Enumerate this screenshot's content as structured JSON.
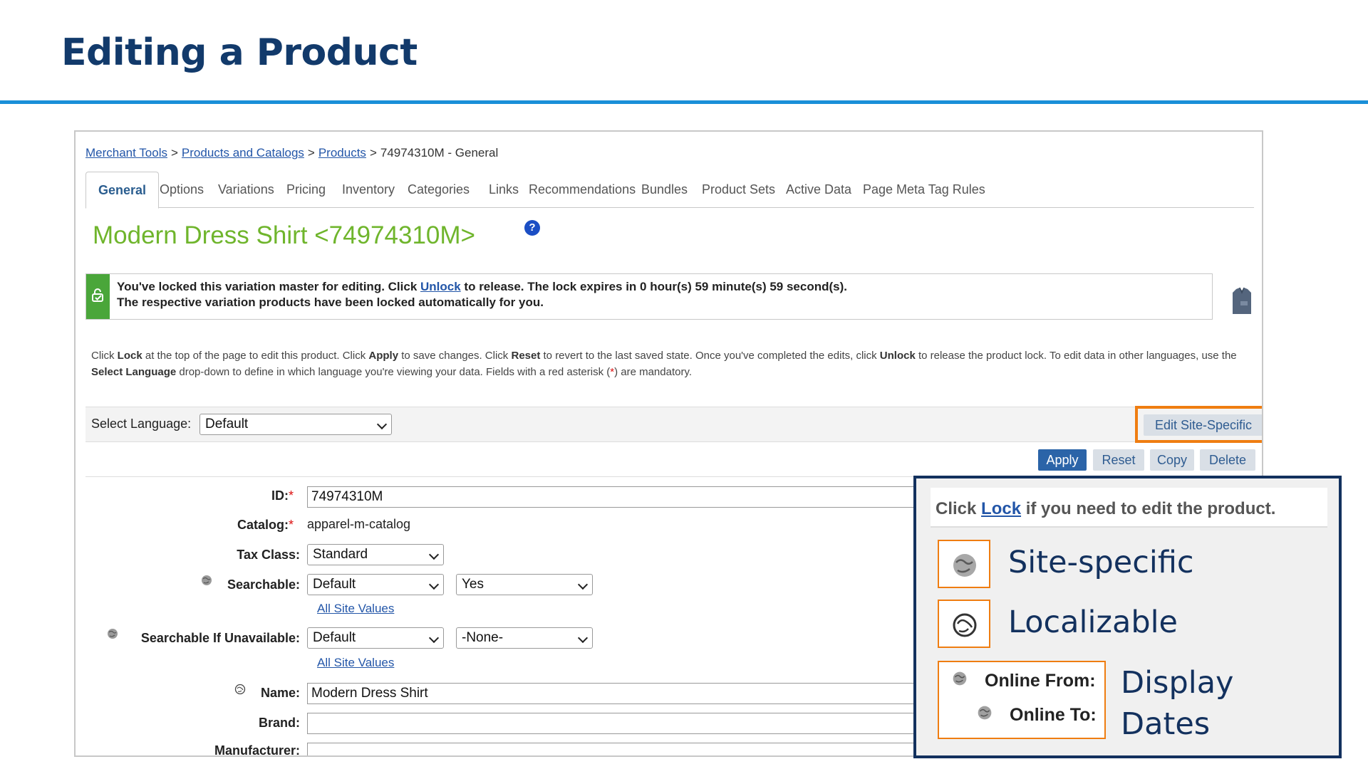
{
  "slide": {
    "title": "Editing a Product"
  },
  "breadcrumb": {
    "items": [
      "Merchant Tools",
      "Products and Catalogs",
      "Products"
    ],
    "current": "74974310M - General",
    "separator": ">"
  },
  "tabs": [
    {
      "label": "General",
      "active": true
    },
    {
      "label": "Options"
    },
    {
      "label": "Variations"
    },
    {
      "label": "Pricing"
    },
    {
      "label": "Inventory"
    },
    {
      "label": "Categories"
    },
    {
      "label": "Links"
    },
    {
      "label": "Recommendations"
    },
    {
      "label": "Bundles"
    },
    {
      "label": "Product Sets"
    },
    {
      "label": "Active Data"
    },
    {
      "label": "Page Meta Tag Rules"
    }
  ],
  "product": {
    "title": "Modern Dress Shirt <74974310M>",
    "help": "?"
  },
  "lock_message": {
    "line1_before": "You've locked this variation master for editing. Click ",
    "line1_link": "Unlock",
    "line1_after": " to release. The lock expires in 0 hour(s) 59 minute(s) 59 second(s).",
    "line2": "The respective variation products have been locked automatically for you."
  },
  "instructions": {
    "t1": "Click ",
    "b1": "Lock",
    "t2": " at the top of the page to edit this product. Click ",
    "b2": "Apply",
    "t3": " to save changes. Click ",
    "b3": "Reset",
    "t4": " to revert to the last saved state. Once you've completed the edits, click ",
    "b4": "Unlock",
    "t5": " to release the product lock. To edit data in other languages, use the ",
    "b5": "Select Language",
    "t6": " drop-down to define in which language you're viewing your data. Fields with a red asterisk (",
    "ast": "*",
    "t7": ") are mandatory."
  },
  "language": {
    "label": "Select Language:",
    "value": "Default"
  },
  "buttons": {
    "edit_site_specific": "Edit Site-Specific",
    "apply": "Apply",
    "reset": "Reset",
    "copy": "Copy",
    "delete": "Delete"
  },
  "form": {
    "required_mark": "*",
    "id": {
      "label": "ID:",
      "value": "74974310M"
    },
    "catalog": {
      "label": "Catalog:",
      "value": "apparel-m-catalog"
    },
    "tax_class": {
      "label": "Tax Class:",
      "value": "Standard"
    },
    "searchable": {
      "label": "Searchable:",
      "scope": "Default",
      "value": "Yes",
      "link": "All Site Values"
    },
    "searchable_unavailable": {
      "label": "Searchable If Unavailable:",
      "scope": "Default",
      "value": "-None-",
      "link": "All Site Values"
    },
    "name": {
      "label": "Name:",
      "value": "Modern Dress Shirt"
    },
    "brand": {
      "label": "Brand:",
      "value": ""
    },
    "manufacturer": {
      "label": "Manufacturer:"
    }
  },
  "legend": {
    "tip_before": "Click ",
    "tip_link": "Lock",
    "tip_after": " if you need to edit the product.",
    "site_specific": "Site-specific",
    "localizable": "Localizable",
    "online_from": "Online From:",
    "online_to": "Online To:",
    "display": "Display",
    "dates": "Dates"
  },
  "colors": {
    "title": "#123a6b",
    "rule": "#1a8fd8",
    "product_title": "#6fb52c",
    "highlight": "#ef7d11",
    "legend_border": "#13315e",
    "apply_button": "#2b64a8"
  }
}
